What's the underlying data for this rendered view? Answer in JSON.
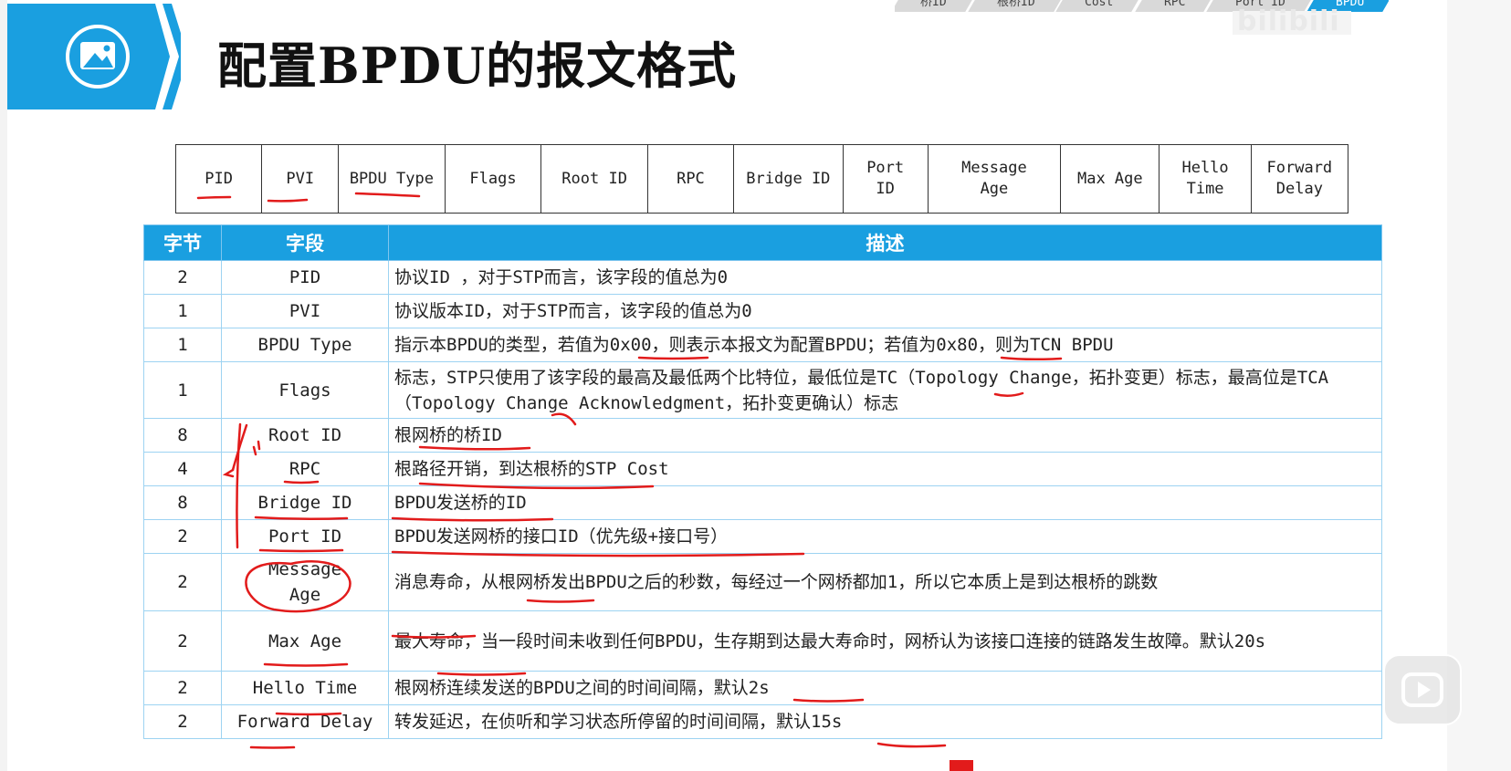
{
  "title": "配置BPDU的报文格式",
  "breadcrumb": [
    "桥ID",
    "根桥ID",
    "Cost",
    "RPC",
    "Port ID",
    "BPDU"
  ],
  "watermark": "bilibili",
  "format_fields": [
    {
      "label": "PID"
    },
    {
      "label": "PVI"
    },
    {
      "label": "BPDU Type"
    },
    {
      "label": "Flags"
    },
    {
      "label": "Root ID"
    },
    {
      "label": "RPC"
    },
    {
      "label": "Bridge ID"
    },
    {
      "label": "Port\nID"
    },
    {
      "label": "Message\nAge"
    },
    {
      "label": "Max Age"
    },
    {
      "label": "Hello\nTime"
    },
    {
      "label": "Forward\nDelay"
    }
  ],
  "table": {
    "headers": [
      "字节",
      "字段",
      "描述"
    ],
    "rows": [
      {
        "bytes": "2",
        "field": "PID",
        "desc": "协议ID ，对于STP而言，该字段的值总为0"
      },
      {
        "bytes": "1",
        "field": "PVI",
        "desc": "协议版本ID，对于STP而言，该字段的值总为0"
      },
      {
        "bytes": "1",
        "field": "BPDU Type",
        "desc": "指示本BPDU的类型，若值为0x00，则表示本报文为配置BPDU；若值为0x80，则为TCN BPDU"
      },
      {
        "bytes": "1",
        "field": "Flags",
        "desc": "标志，STP只使用了该字段的最高及最低两个比特位，最低位是TC（Topology Change，拓扑变更）标志，最高位是TCA（Topology Change Acknowledgment，拓扑变更确认）标志"
      },
      {
        "bytes": "8",
        "field": "Root ID",
        "desc": "根网桥的桥ID"
      },
      {
        "bytes": "4",
        "field": "RPC",
        "desc": "根路径开销，到达根桥的STP Cost"
      },
      {
        "bytes": "8",
        "field": "Bridge ID",
        "desc": "BPDU发送桥的ID"
      },
      {
        "bytes": "2",
        "field": "Port ID",
        "desc": "BPDU发送网桥的接口ID（优先级+接口号）"
      },
      {
        "bytes": "2",
        "field": "Message\nAge",
        "desc": "消息寿命，从根网桥发出BPDU之后的秒数，每经过一个网桥都加1，所以它本质上是到达根桥的跳数"
      },
      {
        "bytes": "2",
        "field": "Max Age",
        "desc": "最大寿命，当一段时间未收到任何BPDU，生存期到达最大寿命时，网桥认为该接口连接的链路发生故障。默认20s"
      },
      {
        "bytes": "2",
        "field": "Hello Time",
        "desc": "根网桥连续发送的BPDU之间的时间间隔，默认2s"
      },
      {
        "bytes": "2",
        "field": "Forward Delay",
        "desc": "转发延迟，在侦听和学习状态所停留的时间间隔，默认15s"
      }
    ]
  },
  "colors": {
    "accent": "#1a9fe0",
    "ink": "#e21b1b"
  }
}
